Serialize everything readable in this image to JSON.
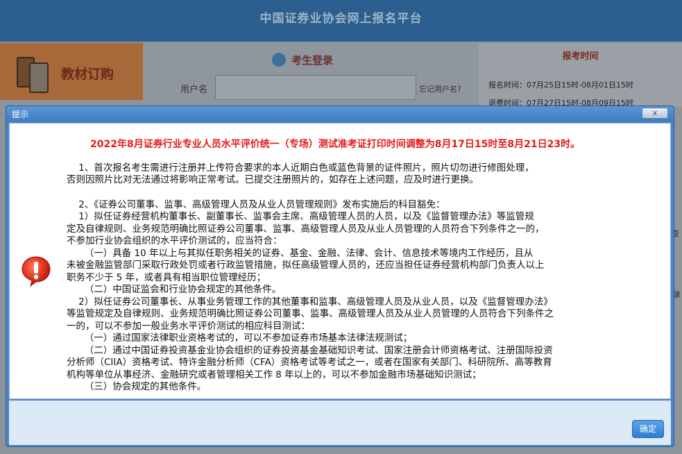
{
  "background": {
    "header_title": "中国证券业协会网上报名平台",
    "book_label": "教材订购",
    "login_title": "考生登录",
    "username_label": "用户名",
    "forgot_link": "忘记用户名?",
    "time_title": "报考时间",
    "time_lines": [
      "报名时间：07月25日15时-08月01日15时",
      "退费时间：07月27日15时-08月09日15时"
    ],
    "side_a": "查",
    "side_b": "录"
  },
  "dialog": {
    "title": "提示",
    "close_label": "x",
    "ok_label": "确定",
    "headline": "2022年8月证券行业专业人员水平评价统一（专场）测试准考证打印时间调整为8月17日15时至8月21日23时。",
    "para1_lines": [
      "    1、首次报名考生需进行注册并上传符合要求的本人近期白色或蓝色背景的证件照片，照片切勿进行修图处理，",
      "否则因照片比对无法通过将影响正常考试。已提交注册照片的，如存在上述问题，应及时进行更换。"
    ],
    "para2_lines": [
      "    2、《证券公司董事、监事、高级管理人员及从业人员管理规则》发布实施后的科目豁免：",
      "    1）拟任证券经营机构董事长、副董事长、监事会主席、高级管理人员的人员，以及《监督管理办法》等监管规",
      "定及自律规则、业务规范明确比照证券公司董事、监事、高级管理人员及从业人员管理的人员符合下列条件之一的，",
      "不参加行业协会组织的水平评价测试的，应当符合：",
      "      （一）具备 10 年以上与其拟任职务相关的证券、基金、金融、法律、会计、信息技术等境内工作经历，且从",
      "未被金融监管部门采取行政处罚或者行政监管措施，拟任高级管理人员的，还应当担任证券经营机构部门负责人以上",
      "职务不少于 5 年，或者具有相当职位管理经历；",
      "      （二）中国证监会和行业协会规定的其他条件。",
      "    2）拟任证券公司董事长、从事业务管理工作的其他董事和监事、高级管理人员及从业人员，以及《监督管理办法》",
      "等监管规定及自律规则、业务规范明确比照证券公司董事、监事、高级管理人员及从业人员管理的人员符合下列条件之",
      "一的，可以不参加一般业务水平评价测试的相应科目测试：",
      "      （一）通过国家法律职业资格考试的，可以不参加证券市场基本法律法规测试；",
      "      （二）通过中国证券投资基金业协会组织的证券投资基金基础知识考试、国家注册会计师资格考试、注册国际投资",
      "分析师（CIIA）资格考试、特许金融分析师（CFA）资格考试等考试之一，或者在国家有关部门、科研院所、高等教育",
      "机构等单位从事经济、金融研究或者管理相关工作 8 年以上的，可以不参加金融市场基础知识测试；",
      "      （三）协会规定的其他条件。"
    ]
  }
}
